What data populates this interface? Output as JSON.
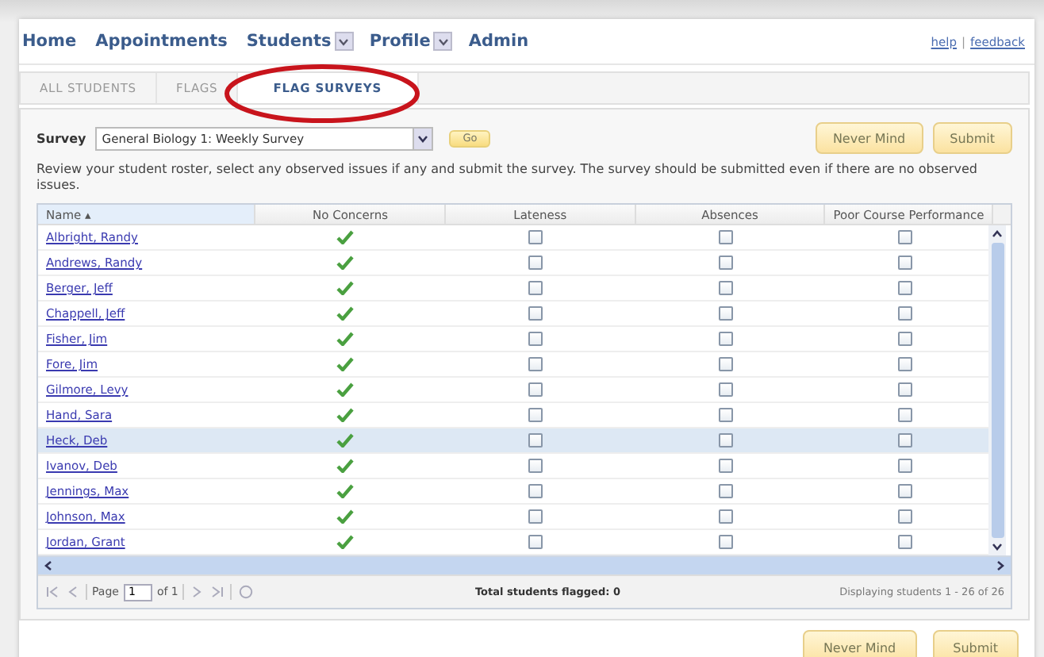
{
  "nav": {
    "items": [
      {
        "label": "Home",
        "dropdown": false
      },
      {
        "label": "Appointments",
        "dropdown": false
      },
      {
        "label": "Students",
        "dropdown": true
      },
      {
        "label": "Profile",
        "dropdown": true
      },
      {
        "label": "Admin",
        "dropdown": false
      }
    ],
    "links": [
      "help",
      "feedback"
    ],
    "separator": "|"
  },
  "tabs": [
    {
      "label": "ALL STUDENTS",
      "selected": false
    },
    {
      "label": "FLAGS",
      "selected": false
    },
    {
      "label": "FLAG SURVEYS",
      "selected": true
    }
  ],
  "annotation": {
    "color": "#c8141c"
  },
  "survey": {
    "label": "Survey",
    "value": "General Biology 1: Weekly Survey",
    "go": "Go",
    "buttons": [
      "Never Mind",
      "Submit"
    ]
  },
  "instructions": "Review your student roster, select any observed issues if any and submit the survey. The survey should be submitted even if there are no observed issues.",
  "table": {
    "columns": [
      "Name ▴",
      "No Concerns",
      "Lateness",
      "Absences",
      "Poor Course Performance"
    ],
    "rows": [
      {
        "name": "Albright, Randy",
        "no_concerns": true,
        "lateness": false,
        "absences": false,
        "performance": false,
        "selected": false
      },
      {
        "name": "Andrews, Randy",
        "no_concerns": true,
        "lateness": false,
        "absences": false,
        "performance": false,
        "selected": false
      },
      {
        "name": "Berger, Jeff",
        "no_concerns": true,
        "lateness": false,
        "absences": false,
        "performance": false,
        "selected": false
      },
      {
        "name": "Chappell, Jeff",
        "no_concerns": true,
        "lateness": false,
        "absences": false,
        "performance": false,
        "selected": false
      },
      {
        "name": "Fisher, Jim",
        "no_concerns": true,
        "lateness": false,
        "absences": false,
        "performance": false,
        "selected": false
      },
      {
        "name": "Fore, Jim",
        "no_concerns": true,
        "lateness": false,
        "absences": false,
        "performance": false,
        "selected": false
      },
      {
        "name": "Gilmore, Levy",
        "no_concerns": true,
        "lateness": false,
        "absences": false,
        "performance": false,
        "selected": false
      },
      {
        "name": "Hand, Sara",
        "no_concerns": true,
        "lateness": false,
        "absences": false,
        "performance": false,
        "selected": false
      },
      {
        "name": "Heck, Deb",
        "no_concerns": true,
        "lateness": false,
        "absences": false,
        "performance": false,
        "selected": true
      },
      {
        "name": "Ivanov, Deb",
        "no_concerns": true,
        "lateness": false,
        "absences": false,
        "performance": false,
        "selected": false
      },
      {
        "name": "Jennings, Max",
        "no_concerns": true,
        "lateness": false,
        "absences": false,
        "performance": false,
        "selected": false
      },
      {
        "name": "Johnson, Max",
        "no_concerns": true,
        "lateness": false,
        "absences": false,
        "performance": false,
        "selected": false
      },
      {
        "name": "Jordan, Grant",
        "no_concerns": true,
        "lateness": false,
        "absences": false,
        "performance": false,
        "selected": false
      }
    ]
  },
  "pager": {
    "page_label": "Page",
    "page": "1",
    "of": "of 1",
    "total": "Total students flagged: 0",
    "displaying": "Displaying students 1 - 26 of 26"
  },
  "bottom_buttons": [
    "Never Mind",
    "Submit"
  ]
}
